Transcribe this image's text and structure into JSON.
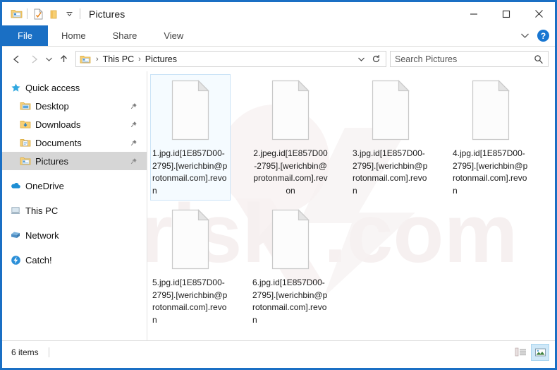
{
  "window": {
    "title": "Pictures",
    "border_color": "#1a6fc4"
  },
  "quick_access_toolbar": {
    "items": [
      {
        "name": "explorer-icon",
        "label": "File Explorer"
      },
      {
        "name": "properties-icon",
        "label": "Properties"
      },
      {
        "name": "new-folder-icon",
        "label": "New folder"
      },
      {
        "name": "customize-chevron-icon",
        "label": "Customize Quick Access Toolbar"
      }
    ]
  },
  "caption_buttons": {
    "minimize": "─",
    "maximize": "☐",
    "close": "✕"
  },
  "ribbon": {
    "tabs": [
      {
        "label": "File",
        "active": true
      },
      {
        "label": "Home",
        "active": false
      },
      {
        "label": "Share",
        "active": false
      },
      {
        "label": "View",
        "active": false
      }
    ],
    "collapse_icon": "chevron-down-icon",
    "help_label": "?"
  },
  "navigation": {
    "back_label": "←",
    "forward_label": "→",
    "recent_label": "⌄",
    "up_label": "↑"
  },
  "address_bar": {
    "crumbs": [
      "This PC",
      "Pictures"
    ],
    "separator": "›",
    "dropdown_icon": "chevron-down-icon",
    "refresh_icon": "refresh-icon"
  },
  "search": {
    "placeholder": "Search Pictures",
    "icon": "search-icon"
  },
  "sidebar": {
    "items": [
      {
        "label": "Quick access",
        "icon": "star-icon",
        "level": "root",
        "pinned": false,
        "selected": false
      },
      {
        "label": "Desktop",
        "icon": "desktop-folder-icon",
        "level": "child",
        "pinned": true,
        "selected": false
      },
      {
        "label": "Downloads",
        "icon": "downloads-folder-icon",
        "level": "child",
        "pinned": true,
        "selected": false
      },
      {
        "label": "Documents",
        "icon": "documents-folder-icon",
        "level": "child",
        "pinned": true,
        "selected": false
      },
      {
        "label": "Pictures",
        "icon": "pictures-folder-icon",
        "level": "child",
        "pinned": true,
        "selected": true
      },
      {
        "label": "OneDrive",
        "icon": "onedrive-cloud-icon",
        "level": "root",
        "pinned": false,
        "selected": false
      },
      {
        "label": "This PC",
        "icon": "this-pc-icon",
        "level": "root",
        "pinned": false,
        "selected": false
      },
      {
        "label": "Network",
        "icon": "network-icon",
        "level": "root",
        "pinned": false,
        "selected": false
      },
      {
        "label": "Catch!",
        "icon": "catch-lightning-icon",
        "level": "root",
        "pinned": false,
        "selected": false
      }
    ]
  },
  "files": [
    {
      "name": "1.jpg.id[1E857D00-2795].[werichbin@protonmail.com].revon",
      "selected": true,
      "centered": false
    },
    {
      "name": "2.jpeg.id[1E857D00-2795].[werichbin@protonmail.com].revon",
      "selected": false,
      "centered": true
    },
    {
      "name": "3.jpg.id[1E857D00-2795].[werichbin@protonmail.com].revon",
      "selected": false,
      "centered": false
    },
    {
      "name": "4.jpg.id[1E857D00-2795].[werichbin@protonmail.com].revon",
      "selected": false,
      "centered": false
    },
    {
      "name": "5.jpg.id[1E857D00-2795].[werichbin@protonmail.com].revon",
      "selected": false,
      "centered": false
    },
    {
      "name": "6.jpg.id[1E857D00-2795].[werichbin@protonmail.com].revon",
      "selected": false,
      "centered": false
    }
  ],
  "status_bar": {
    "item_count": "6 items",
    "views": [
      {
        "name": "details-view-button",
        "active": false
      },
      {
        "name": "large-icons-view-button",
        "active": true
      }
    ]
  }
}
